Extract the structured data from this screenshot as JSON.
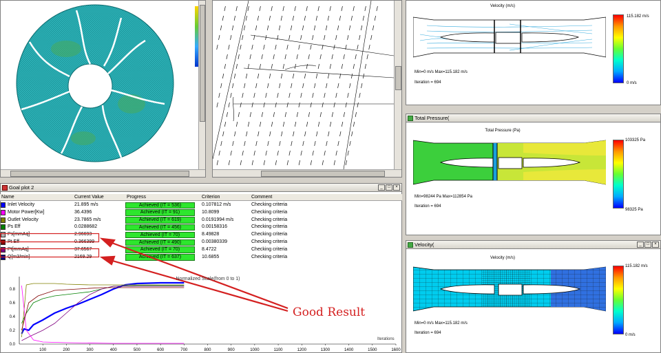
{
  "goal_window": {
    "title": "Goal plot 2"
  },
  "goal_table": {
    "headers": [
      "Name",
      "Current Value",
      "Progress",
      "Criterion",
      "Comment"
    ],
    "rows": [
      {
        "name": "Inlet Velocity",
        "value": "21.895 m/s",
        "progress": "Achieved (IT = 536)",
        "criterion": "0.107812 m/s",
        "comment": "Checking criteria",
        "color": "#0000ff"
      },
      {
        "name": "Motor Power[Kw]",
        "value": "36.4396",
        "progress": "Achieved (IT = 91)",
        "criterion": "10.8099",
        "comment": "Checking criteria",
        "color": "#ff00ff"
      },
      {
        "name": "Outlet Velocity",
        "value": "23.7865 m/s",
        "progress": "Achieved (IT = 619)",
        "criterion": "0.0191994 m/s",
        "comment": "Checking criteria",
        "color": "#808000"
      },
      {
        "name": "Ps Eff",
        "value": "0.0288682",
        "progress": "Achieved (IT = 456)",
        "criterion": "0.00158316",
        "comment": "Checking criteria",
        "color": "#008000"
      },
      {
        "name": "Ps[mmAq]",
        "value": "2.96693",
        "progress": "Achieved (IT = 70)",
        "criterion": "8.49828",
        "comment": "Checking criteria",
        "color": "#b0b0b0"
      },
      {
        "name": "Pt Eff",
        "value": "0.366399",
        "progress": "Achieved (IT = 490)",
        "criterion": "0.00380339",
        "comment": "Checking criteria",
        "color": "#800000"
      },
      {
        "name": "Pt[mmAq]",
        "value": "37.6567",
        "progress": "Achieved (IT = 70)",
        "criterion": "8.4722",
        "comment": "Checking criteria",
        "color": "#800080"
      },
      {
        "name": "Q[m3/min]",
        "value": "2169.29",
        "progress": "Achieved (IT = 637)",
        "criterion": "10.6855",
        "comment": "Checking criteria",
        "color": "#000080"
      }
    ]
  },
  "annotation": {
    "text": "Good Result"
  },
  "chart_data": {
    "type": "line",
    "title": "Normalized Scale(from 0 to 1)",
    "xlabel": "Iterations",
    "ylabel": "",
    "xlim": [
      0,
      1600
    ],
    "ylim": [
      0,
      0.9
    ],
    "x_ticks": [
      "100",
      "200",
      "300",
      "400",
      "500",
      "600",
      "700",
      "800",
      "900",
      "1000",
      "1100",
      "1200",
      "1300",
      "1400",
      "1500",
      "1600"
    ],
    "y_ticks": [
      "0.0",
      "0.2",
      "0.4",
      "0.6",
      "0.8"
    ],
    "series": [
      {
        "color": "#0000ff",
        "x": [
          10,
          20,
          40,
          60,
          100,
          150,
          200,
          250,
          300,
          350,
          400,
          450,
          500,
          600,
          700
        ],
        "y": [
          0.15,
          0.22,
          0.2,
          0.28,
          0.35,
          0.45,
          0.52,
          0.58,
          0.65,
          0.72,
          0.8,
          0.86,
          0.88,
          0.89,
          0.89
        ]
      },
      {
        "color": "#808000",
        "x": [
          10,
          30,
          60,
          100,
          150,
          200,
          300,
          400,
          500,
          600,
          700
        ],
        "y": [
          0.1,
          0.86,
          0.88,
          0.88,
          0.88,
          0.87,
          0.86,
          0.86,
          0.86,
          0.86,
          0.86
        ]
      },
      {
        "color": "#008000",
        "x": [
          10,
          30,
          60,
          100,
          150,
          200,
          250,
          300,
          350,
          400,
          500,
          700
        ],
        "y": [
          0.3,
          0.45,
          0.6,
          0.66,
          0.7,
          0.72,
          0.74,
          0.76,
          0.8,
          0.84,
          0.85,
          0.85
        ]
      },
      {
        "color": "#800080",
        "x": [
          10,
          50,
          100,
          150,
          200,
          250,
          300,
          350,
          400,
          500,
          700
        ],
        "y": [
          0.05,
          0.12,
          0.2,
          0.3,
          0.45,
          0.6,
          0.72,
          0.8,
          0.84,
          0.84,
          0.84
        ]
      },
      {
        "color": "#ff00ff",
        "x": [
          10,
          30,
          60,
          100,
          200,
          400,
          700
        ],
        "y": [
          0.85,
          0.2,
          0.06,
          0.03,
          0.02,
          0.01,
          0.01
        ]
      },
      {
        "color": "#800000",
        "x": [
          10,
          40,
          80,
          150,
          250,
          350,
          500,
          700
        ],
        "y": [
          0.2,
          0.6,
          0.7,
          0.78,
          0.8,
          0.82,
          0.82,
          0.82
        ]
      }
    ]
  },
  "plots": {
    "velocity_contour": {
      "caption": "Velocity (m/s)",
      "max_label": "115.182 m/s",
      "min_label": "0 m/s",
      "range_text": "Min=0 m/s   Max=115.182 m/s",
      "iteration": "Iteration = 694"
    },
    "pressure": {
      "window_title": "Total Pressure(",
      "caption": "Total Pressure (Pa)",
      "max_label": "103325 Pa",
      "min_label": "98325 Pa",
      "range_text": "Min=98244 Pa   Max=112854 Pa",
      "iteration": "Iteration = 694"
    },
    "velocity_mesh": {
      "window_title": "Velocity(",
      "caption": "Velocity (m/s)",
      "max_label": "115.182 m/s",
      "min_label": "0 m/s",
      "range_text": "Min=0 m/s   Max=115.182 m/s",
      "iteration": "Iteration = 694"
    }
  }
}
